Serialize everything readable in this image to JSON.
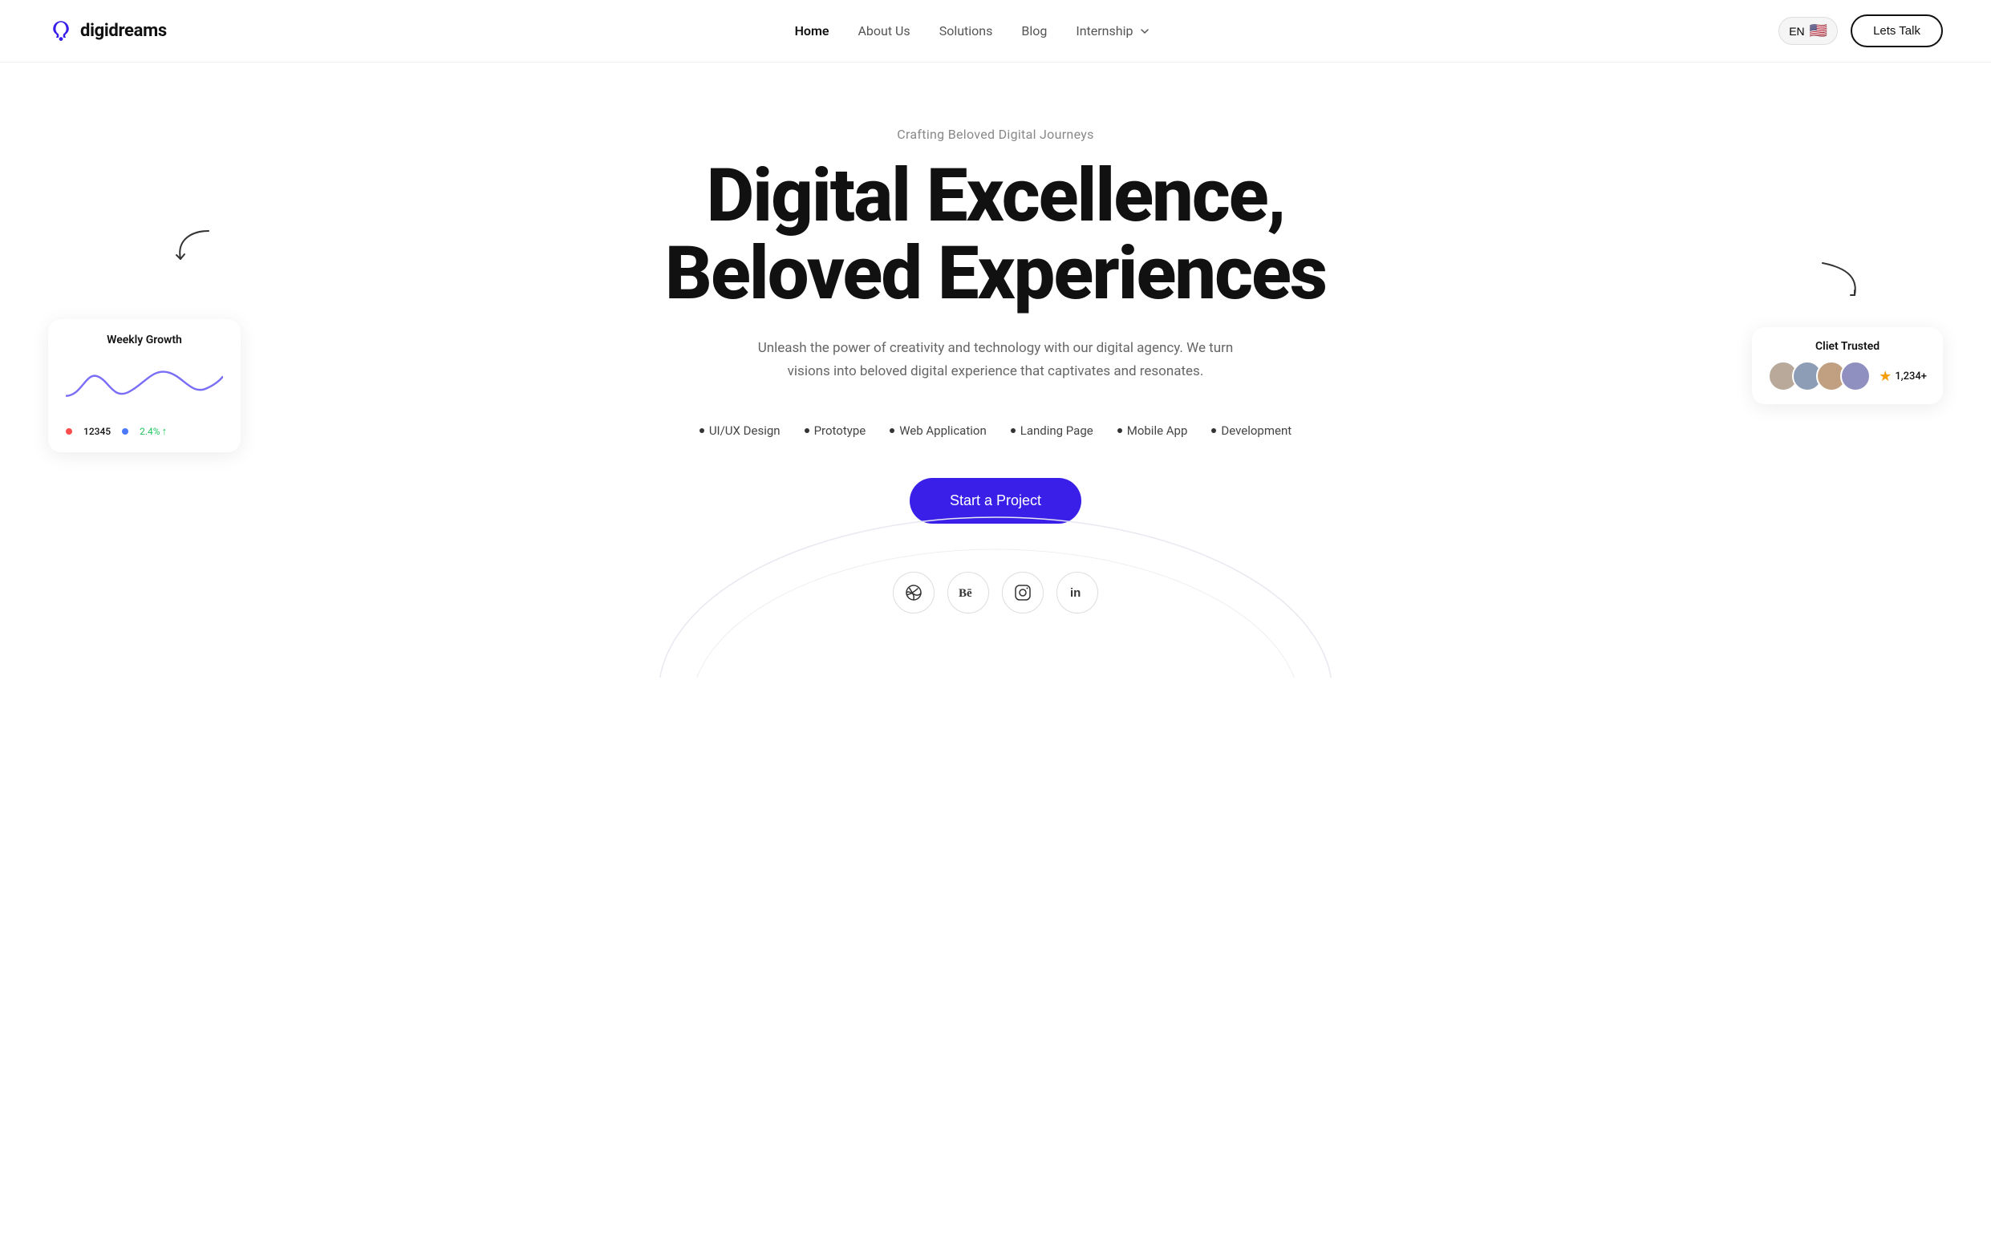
{
  "nav": {
    "logo_text_prefix": "digi",
    "logo_text_bold": "dreams",
    "links": [
      {
        "label": "Home",
        "active": true
      },
      {
        "label": "About Us",
        "active": false
      },
      {
        "label": "Solutions",
        "active": false
      },
      {
        "label": "Blog",
        "active": false
      },
      {
        "label": "Internship",
        "active": false,
        "has_dropdown": true
      }
    ],
    "lang": "EN",
    "lets_talk": "Lets Talk"
  },
  "hero": {
    "subtitle": "Crafting Beloved Digital Journeys",
    "title_line1": "Digital Excellence,",
    "title_line2": "Beloved Experiences",
    "description": "Unleash the power of creativity and technology with our digital agency. We turn visions into beloved digital experience that captivates and resonates.",
    "tags": [
      "UI/UX Design",
      "Prototype",
      "Web Application",
      "Landing Page",
      "Mobile App",
      "Development"
    ],
    "cta_button": "Start a Project"
  },
  "social": {
    "icons": [
      {
        "name": "dribbble",
        "symbol": "⊕"
      },
      {
        "name": "behance",
        "symbol": "Bē"
      },
      {
        "name": "instagram",
        "symbol": "◯"
      },
      {
        "name": "linkedin",
        "symbol": "in"
      }
    ]
  },
  "weekly_growth": {
    "title": "Weekly Growth",
    "value": "12345",
    "percent": "2.4%"
  },
  "client_trusted": {
    "title": "Cliet Trusted",
    "rating": "1,234+",
    "avatars": [
      "👤",
      "👤",
      "👤",
      "👤"
    ]
  }
}
